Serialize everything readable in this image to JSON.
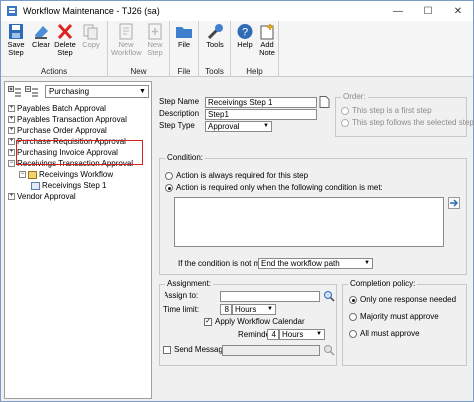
{
  "window": {
    "title": "Workflow Maintenance  -  TJ26 (sa)",
    "minimize": "—",
    "maximize": "☐",
    "close": "✕"
  },
  "ribbon": {
    "groups": [
      {
        "label": "Actions",
        "buttons": [
          "Save\nStep",
          "Clear",
          "Delete\nStep",
          "Copy"
        ]
      },
      {
        "label": "New",
        "buttons": [
          "New\nWorkflow",
          "New\nStep"
        ]
      },
      {
        "label": "File",
        "buttons": [
          "File"
        ]
      },
      {
        "label": "Tools",
        "buttons": [
          "Tools"
        ]
      },
      {
        "label": "Help",
        "buttons": [
          "Help",
          "Add\nNote"
        ]
      }
    ],
    "save": "Save Step",
    "clear": "Clear",
    "delete": "Delete Step",
    "copy": "Copy",
    "new_workflow": "New Workflow",
    "new_step": "New Step",
    "file": "File",
    "tools": "Tools",
    "help": "Help",
    "add_note": "Add Note",
    "group_actions": "Actions",
    "group_new": "New",
    "group_file": "File",
    "group_tools": "Tools",
    "group_help": "Help"
  },
  "tree": {
    "filter": "Purchasing",
    "items": [
      {
        "label": "Payables Batch Approval"
      },
      {
        "label": "Payables Transaction Approval"
      },
      {
        "label": "Purchase Order Approval"
      },
      {
        "label": "Purchase Requisition Approval"
      },
      {
        "label": "Purchasing Invoice Approval"
      },
      {
        "label": "Receivings Transaction Approval"
      },
      {
        "label": "Receivings Workflow"
      },
      {
        "label": "Receivings Step 1"
      },
      {
        "label": "Vendor Approval"
      }
    ]
  },
  "step": {
    "name_label": "Step Name",
    "name_value": "Receivings Step 1",
    "description_label": "Description",
    "description_value": "Step1",
    "type_label": "Step Type",
    "type_value": "Approval"
  },
  "order": {
    "title": "Order:",
    "first": "This step is a first step",
    "follows": "This step follows the selected step:"
  },
  "condition": {
    "title": "Condition:",
    "always": "Action is always required for this step",
    "when_met": "Action is required only when the following condition is met:",
    "not_met_label": "If the condition is not met:",
    "not_met_value": "End the workflow path"
  },
  "assignment": {
    "title": "Assignment:",
    "assign_to_label": "Assign to:",
    "time_limit_label": "Time limit:",
    "time_limit_value": "8",
    "time_limit_unit": "Hours",
    "apply_calendar": "Apply Workflow Calendar",
    "reminder_label": "Reminder:",
    "reminder_value": "4",
    "reminder_unit": "Hours",
    "send_message": "Send Message:"
  },
  "completion": {
    "title": "Completion policy:",
    "one": "Only one response needed",
    "majority": "Majority must approve",
    "all": "All must approve"
  },
  "colors": {
    "highlight_border": "#d42020",
    "window_border": "#7a9cc9"
  }
}
